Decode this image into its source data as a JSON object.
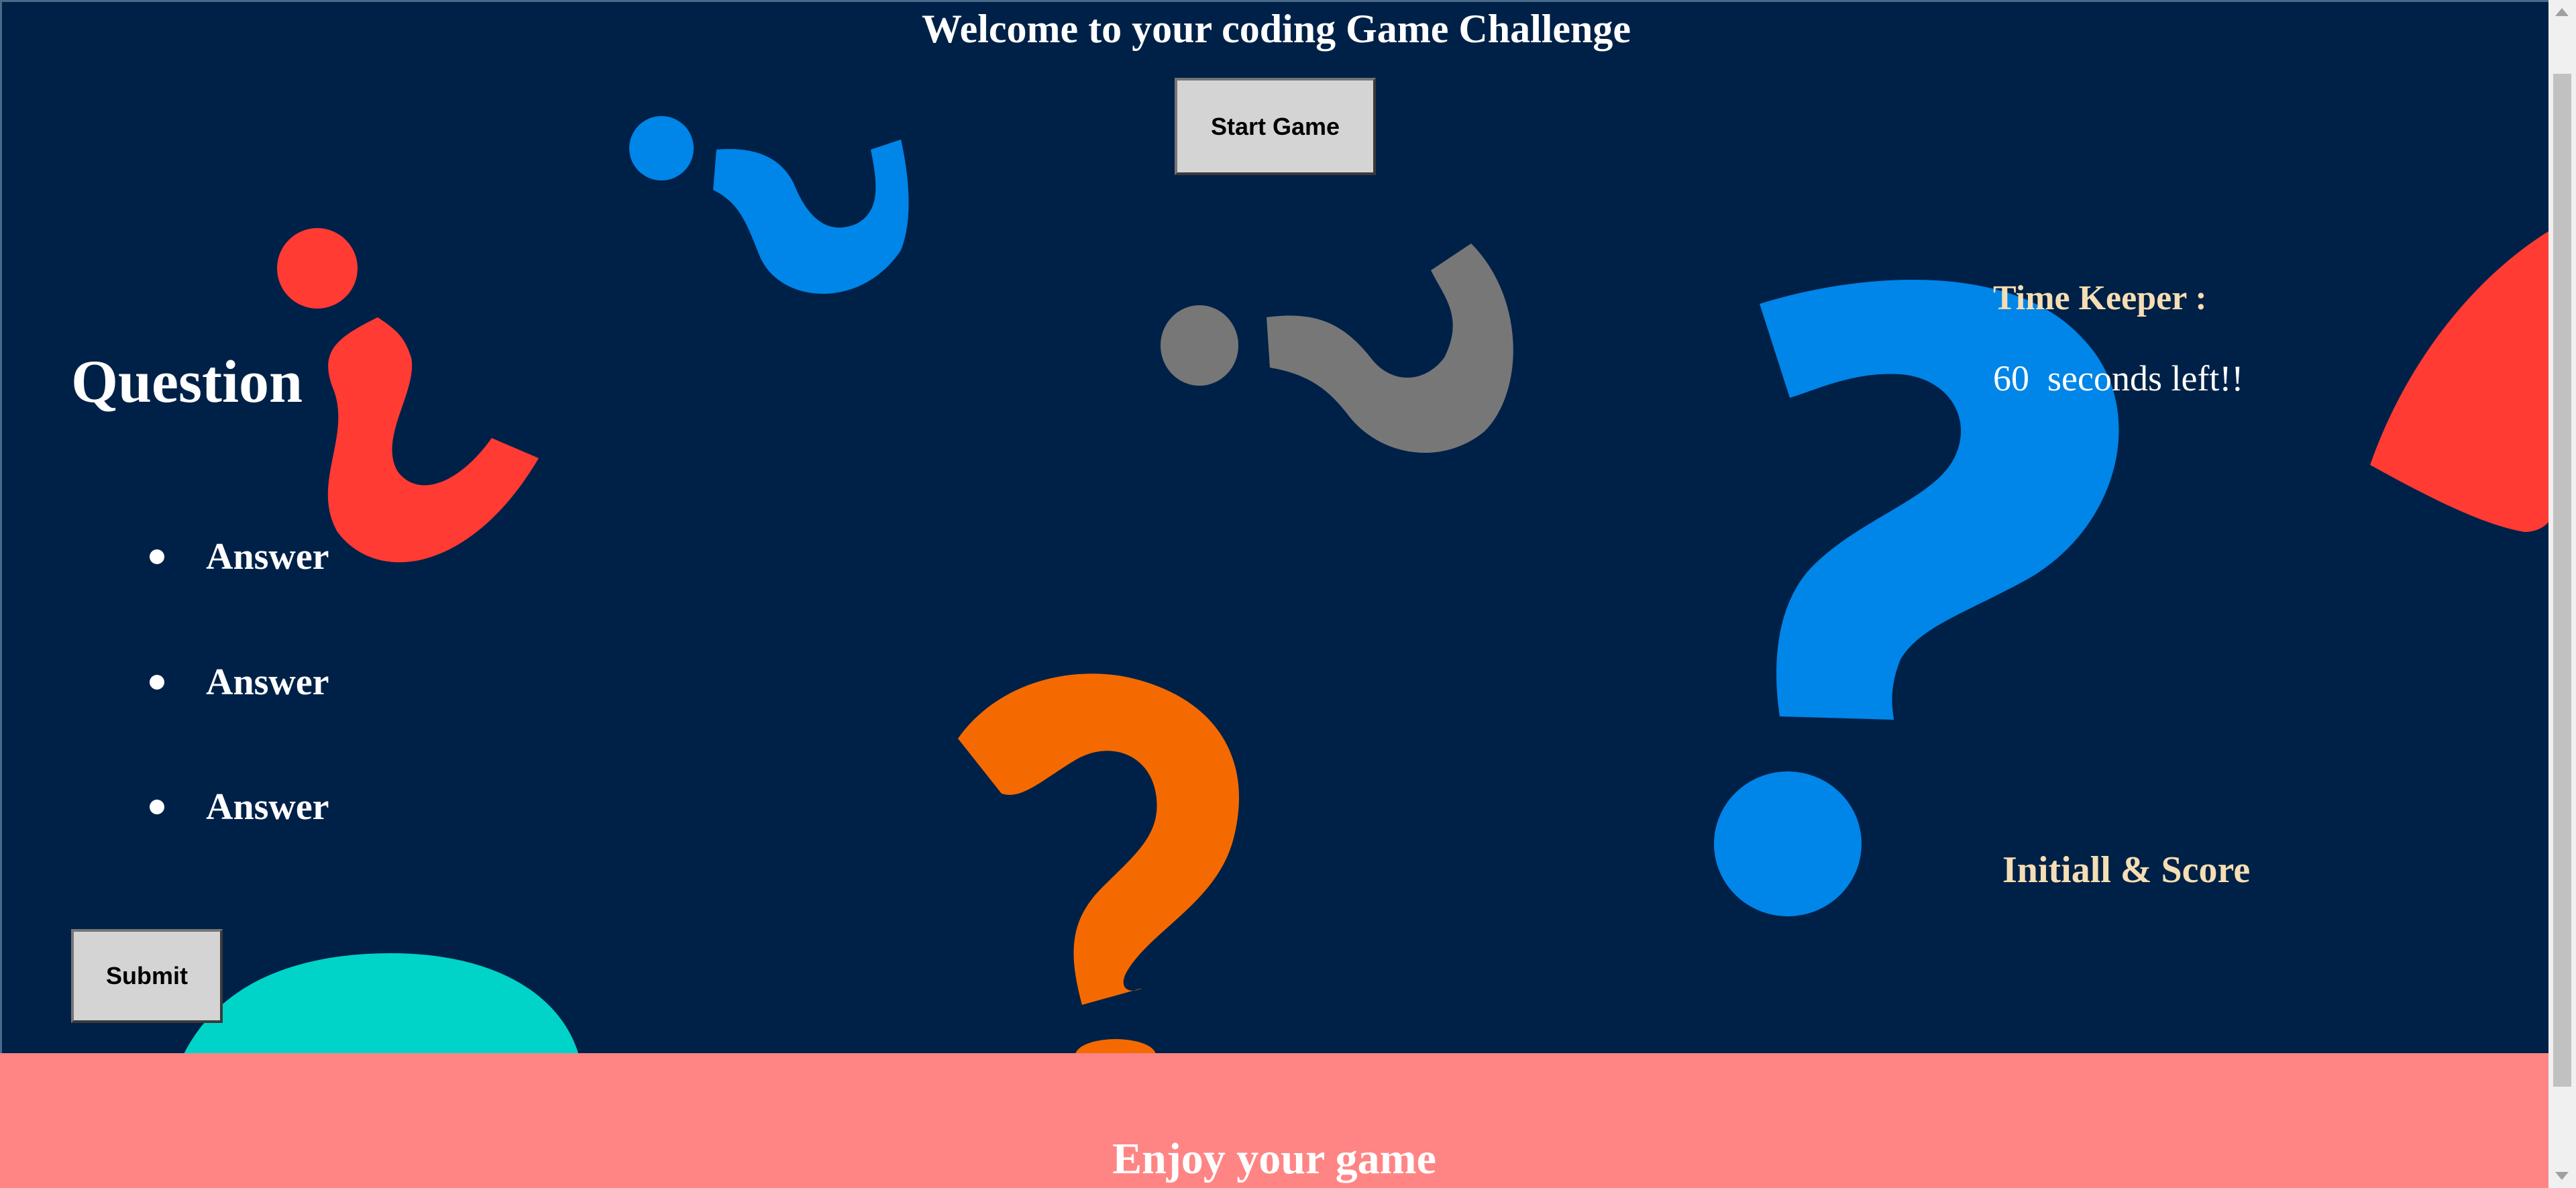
{
  "header": {
    "title": "Welcome to your coding Game Challenge",
    "start_button": "Start Game"
  },
  "quiz": {
    "question": "Question",
    "answers": [
      "Answer",
      "Answer",
      "Answer"
    ],
    "submit_button": "Submit"
  },
  "timer": {
    "label": "Time Keeper :",
    "seconds": "60",
    "suffix": "seconds left!!"
  },
  "scores": {
    "label": "Initiall & Score"
  },
  "footer": {
    "text": "Enjoy your game"
  },
  "colors": {
    "background": "#002147",
    "footer": "#ff8585",
    "label_accent": "#f5deb3",
    "deco_red": "#ff3b33",
    "deco_blue": "#0085e8",
    "deco_gray": "#777777",
    "deco_orange": "#f56a00",
    "deco_teal": "#00d4c8"
  },
  "icons": [
    "question-mark-decoration-icon",
    "inverted-question-mark-decoration-icon"
  ]
}
